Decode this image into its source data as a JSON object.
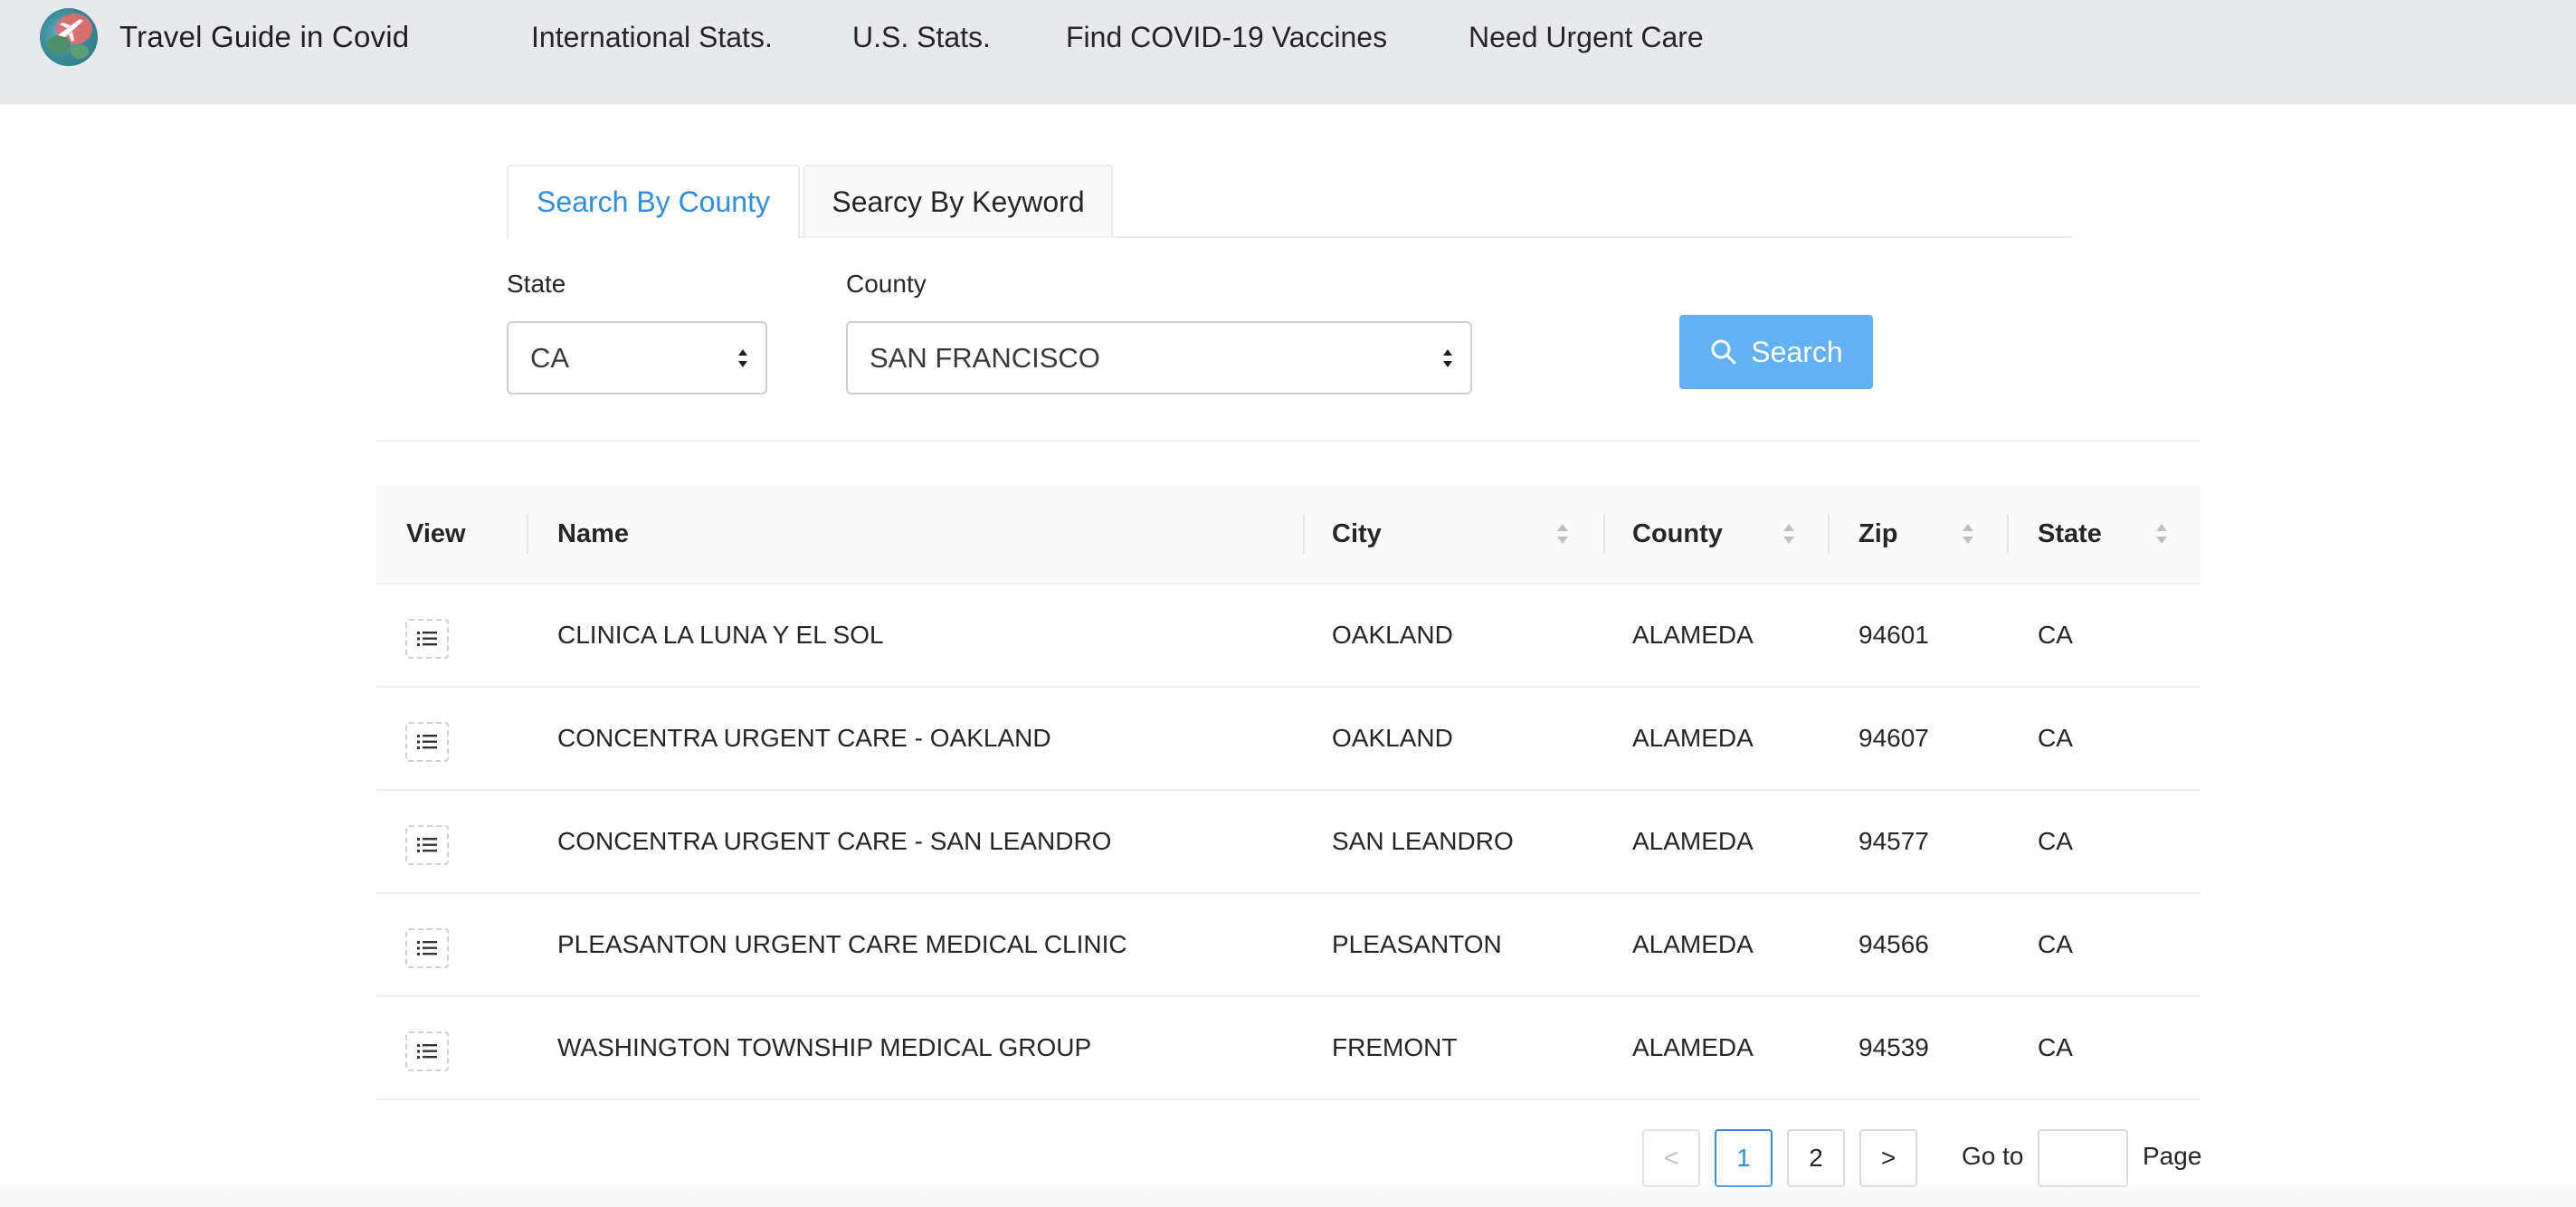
{
  "header": {
    "brand_title": "Travel Guide in Covid",
    "logo_icon": "globe-airplane-logo",
    "nav": [
      {
        "label": "International Stats."
      },
      {
        "label": "U.S. Stats."
      },
      {
        "label": "Find COVID-19 Vaccines"
      },
      {
        "label": "Need Urgent Care"
      }
    ]
  },
  "tabs": [
    {
      "label": "Search By County",
      "active": true
    },
    {
      "label": "Searcy By Keyword",
      "active": false
    }
  ],
  "form": {
    "state_label": "State",
    "state_value": "CA",
    "county_label": "County",
    "county_value": "SAN FRANCISCO",
    "search_label": "Search",
    "search_icon": "search-icon"
  },
  "table": {
    "columns": [
      {
        "label": "View",
        "sortable": false
      },
      {
        "label": "Name",
        "sortable": false
      },
      {
        "label": "City",
        "sortable": true
      },
      {
        "label": "County",
        "sortable": true
      },
      {
        "label": "Zip",
        "sortable": true
      },
      {
        "label": "State",
        "sortable": true
      }
    ],
    "view_icon": "list-icon",
    "rows": [
      {
        "name": "CLINICA LA LUNA Y EL SOL",
        "city": "OAKLAND",
        "county": "ALAMEDA",
        "zip": "94601",
        "state": "CA"
      },
      {
        "name": "CONCENTRA URGENT CARE - OAKLAND",
        "city": "OAKLAND",
        "county": "ALAMEDA",
        "zip": "94607",
        "state": "CA"
      },
      {
        "name": "CONCENTRA URGENT CARE - SAN LEANDRO",
        "city": "SAN LEANDRO",
        "county": "ALAMEDA",
        "zip": "94577",
        "state": "CA"
      },
      {
        "name": "PLEASANTON URGENT CARE MEDICAL CLINIC",
        "city": "PLEASANTON",
        "county": "ALAMEDA",
        "zip": "94566",
        "state": "CA"
      },
      {
        "name": "WASHINGTON TOWNSHIP MEDICAL GROUP",
        "city": "FREMONT",
        "county": "ALAMEDA",
        "zip": "94539",
        "state": "CA"
      }
    ]
  },
  "pagination": {
    "prev": "<",
    "pages": [
      "1",
      "2"
    ],
    "current_page": "1",
    "next": ">",
    "goto_label": "Go to",
    "goto_value": "",
    "page_label": "Page"
  },
  "colors": {
    "accent": "#2f8ee8",
    "button": "#64b0f5",
    "header_bg": "#e8e9ec"
  }
}
